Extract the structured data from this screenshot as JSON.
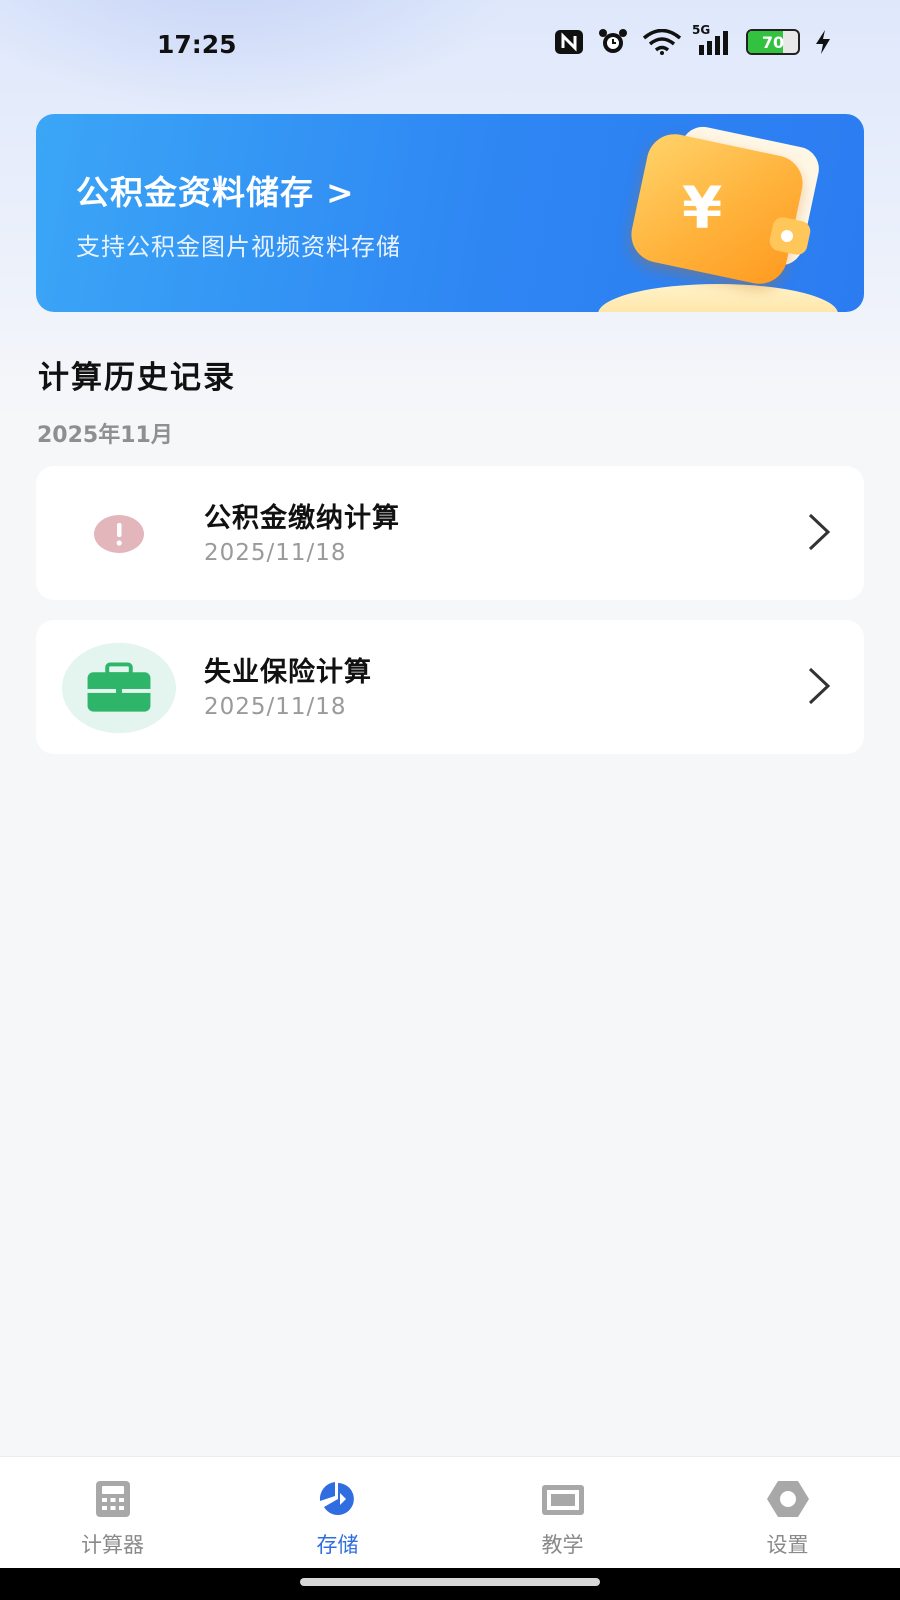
{
  "status_bar": {
    "time": "17:25",
    "network": "5G",
    "battery_level": "70",
    "icons": [
      "nfc-icon",
      "alarm-icon",
      "wifi-icon",
      "signal-icon",
      "battery-icon",
      "charging-icon"
    ]
  },
  "banner": {
    "title": "公积金资料储存",
    "chevron": ">",
    "subtitle": "支持公积金图片视频资料存储",
    "icon": "wallet-yen-icon"
  },
  "history": {
    "section_title": "计算历史记录",
    "month": "2025年11月",
    "items": [
      {
        "title": "公积金缴纳计算",
        "date": "2025/11/18",
        "icon": "alert-icon",
        "icon_color": "#d9a7ad"
      },
      {
        "title": "失业保险计算",
        "date": "2025/11/18",
        "icon": "briefcase-icon",
        "icon_color": "#2fb56a"
      }
    ]
  },
  "bottom_nav": {
    "items": [
      {
        "label": "计算器",
        "icon": "calculator-icon",
        "active": false
      },
      {
        "label": "存储",
        "icon": "storage-icon",
        "active": true
      },
      {
        "label": "教学",
        "icon": "teaching-icon",
        "active": false
      },
      {
        "label": "设置",
        "icon": "settings-icon",
        "active": false
      }
    ]
  },
  "colors": {
    "accent": "#2f6de0",
    "banner_start": "#3ba6f6",
    "banner_end": "#2c7cf1",
    "background": "#f6f7f9"
  }
}
